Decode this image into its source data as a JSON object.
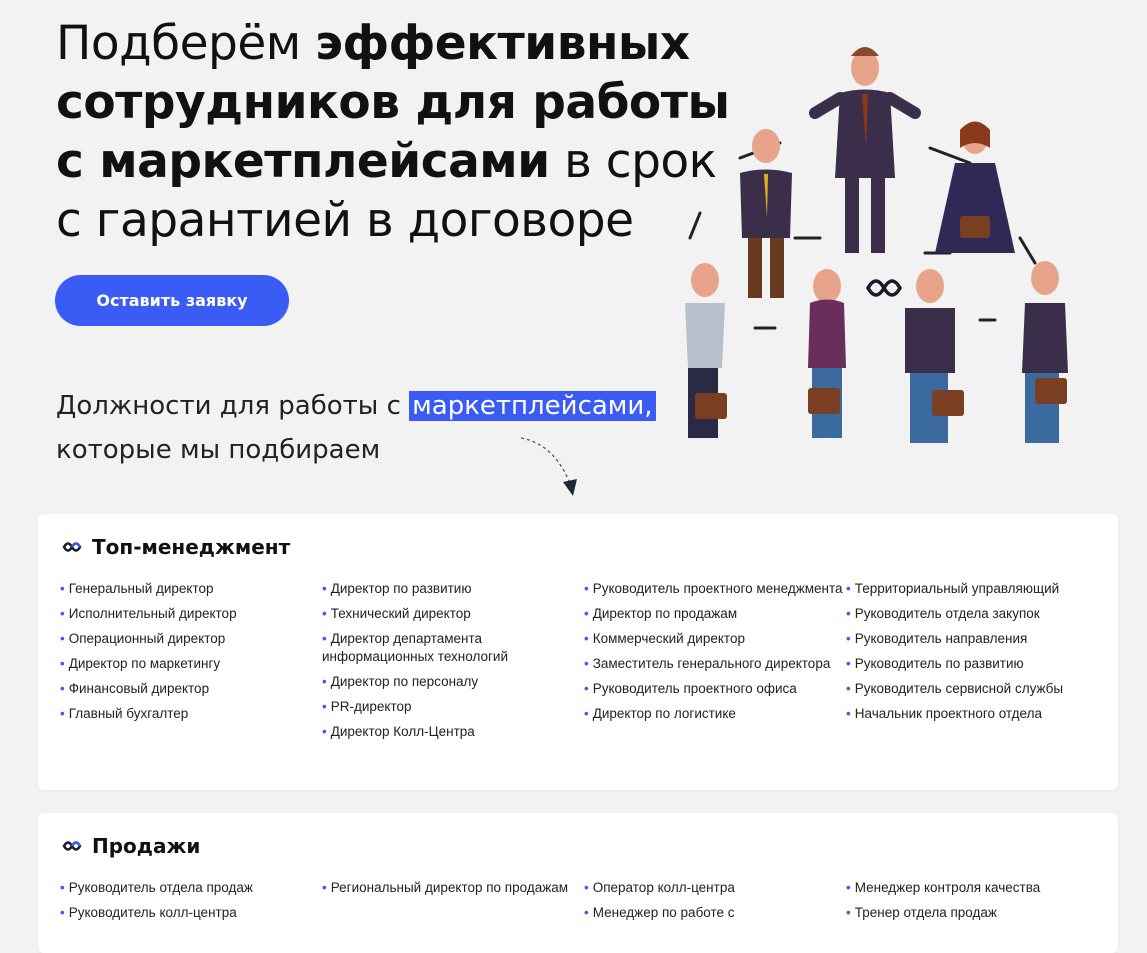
{
  "hero": {
    "lines": [
      {
        "normal": "Подберём ",
        "bold": "эффективных"
      },
      {
        "normal": "",
        "bold": "сотрудников для работы"
      },
      {
        "normal_after": " в срок",
        "bold": "с маркетплейсами"
      },
      {
        "normal": "с гарантией в договоре",
        "bold": ""
      }
    ],
    "cta_label": "Оставить заявку"
  },
  "positions": {
    "prefix": "Должности для работы с ",
    "highlight": "маркетплейсами,",
    "suffix": "которые мы подбираем"
  },
  "colors": {
    "accent": "#3b5bf5",
    "background": "#f2f2f2",
    "card": "#ffffff"
  },
  "icons": {
    "category_icon": "infinity-logo-icon",
    "arrow": "dashed-arrow-icon"
  },
  "categories": [
    {
      "title": "Топ-менеджмент",
      "columns": [
        [
          "Генеральный директор",
          "Исполнительный директор",
          "Операционный директор",
          "Директор по маркетингу",
          "Финансовый директор",
          "Главный бухгалтер"
        ],
        [
          "Директор по развитию",
          "Технический директор",
          "Директор департамента информационных технологий",
          "Директор по персоналу",
          "PR-директор",
          "Директор Колл-Центра"
        ],
        [
          "Руководитель проектного менеджмента",
          "Директор по продажам",
          "Коммерческий директор",
          "Заместитель генерального директора",
          "Руководитель проектного офиса",
          "Директор по логистике"
        ],
        [
          "Территориальный управляющий",
          "Руководитель отдела закупок",
          "Руководитель направления",
          "Руководитель по развитию",
          "Руководитель сервисной службы",
          "Начальник проектного отдела"
        ]
      ]
    },
    {
      "title": "Продажи",
      "columns": [
        [
          "Руководитель отдела продаж",
          "Руководитель колл-центра"
        ],
        [
          "Региональный директор по продажам"
        ],
        [
          "Оператор колл-центра",
          "Менеджер по работе с"
        ],
        [
          "Менеджер контроля качества",
          "Тренер отдела продаж"
        ]
      ]
    }
  ]
}
